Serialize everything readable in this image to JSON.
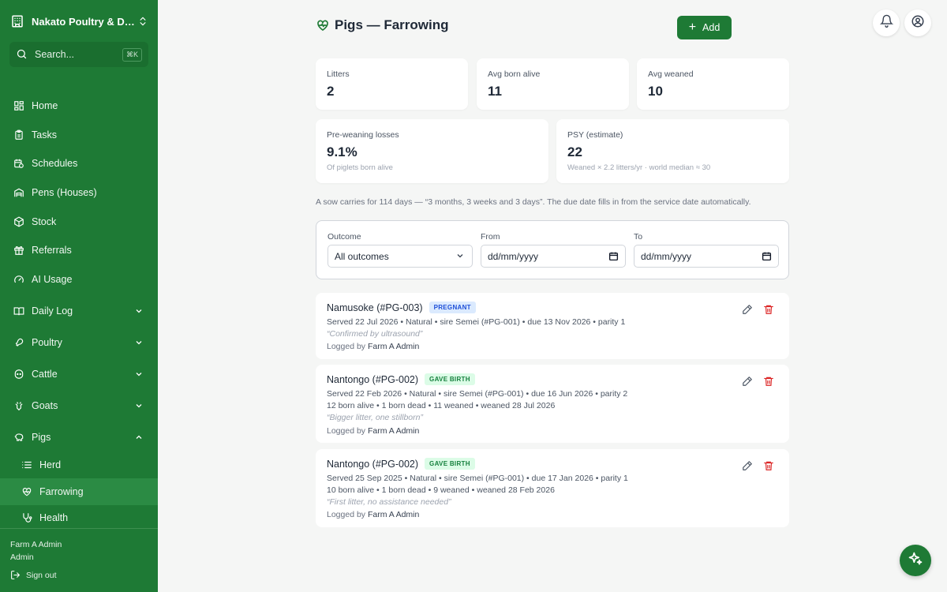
{
  "sidebar": {
    "org_name": "Nakato Poultry & Da...",
    "search_placeholder": "Search...",
    "search_shortcut": "⌘K",
    "items": {
      "home": "Home",
      "tasks": "Tasks",
      "schedules": "Schedules",
      "pens": "Pens (Houses)",
      "stock": "Stock",
      "referrals": "Referrals",
      "ai_usage": "AI Usage",
      "daily_log": "Daily Log",
      "poultry": "Poultry",
      "cattle": "Cattle",
      "goats": "Goats",
      "pigs": "Pigs",
      "herd": "Herd",
      "farrowing": "Farrowing",
      "health": "Health"
    },
    "user_name": "Farm A Admin",
    "user_role": "Admin",
    "sign_out": "Sign out",
    "active_item": "Farrowing"
  },
  "header": {
    "title": "Pigs — Farrowing",
    "add_label": "Add"
  },
  "stats": {
    "litters": {
      "label": "Litters",
      "value": "2"
    },
    "avg_born_alive": {
      "label": "Avg born alive",
      "value": "11"
    },
    "avg_weaned": {
      "label": "Avg weaned",
      "value": "10"
    },
    "pre_weaning": {
      "label": "Pre-weaning losses",
      "value": "9.1%",
      "sub": "Of piglets born alive"
    },
    "psy": {
      "label": "PSY (estimate)",
      "value": "22",
      "sub": "Weaned × 2.2 litters/yr · world median ≈ 30"
    }
  },
  "info_text": "A sow carries for 114 days — “3 months, 3 weeks and 3 days”. The due date fills in from the service date automatically.",
  "filters": {
    "outcome_label": "Outcome",
    "outcome_value": "All outcomes",
    "from_label": "From",
    "from_value": "dd/mm/yyyy",
    "to_label": "To",
    "to_value": "dd/mm/yyyy"
  },
  "records": [
    {
      "name": "Namusoke (#PG-003)",
      "status": "PREGNANT",
      "line1": "Served 22 Jul 2026 • Natural • sire Semei (#PG-001) • due 13 Nov 2026 • parity 1",
      "note": "“Confirmed by ultrasound”",
      "logged_prefix": "Logged by",
      "logged_by": "Farm A Admin"
    },
    {
      "name": "Nantongo (#PG-002)",
      "status": "GAVE BIRTH",
      "line1": "Served 22 Feb 2026 • Natural • sire Semei (#PG-001) • due 16 Jun 2026 • parity 2",
      "line2": "12 born alive • 1 born dead • 11 weaned • weaned 28 Jul 2026",
      "note": "“Bigger litter, one stillborn”",
      "logged_prefix": "Logged by",
      "logged_by": "Farm A Admin"
    },
    {
      "name": "Nantongo (#PG-002)",
      "status": "GAVE BIRTH",
      "line1": "Served 25 Sep 2025 • Natural • sire Semei (#PG-001) • due 17 Jan 2026 • parity 1",
      "line2": "10 born alive • 1 born dead • 9 weaned • weaned 28 Feb 2026",
      "note": "“First litter, no assistance needed”",
      "logged_prefix": "Logged by",
      "logged_by": "Farm A Admin"
    }
  ],
  "colors": {
    "brand_green": "#1e7a35",
    "active_nav": "#2b8b44",
    "delete_red": "#dc2626"
  }
}
